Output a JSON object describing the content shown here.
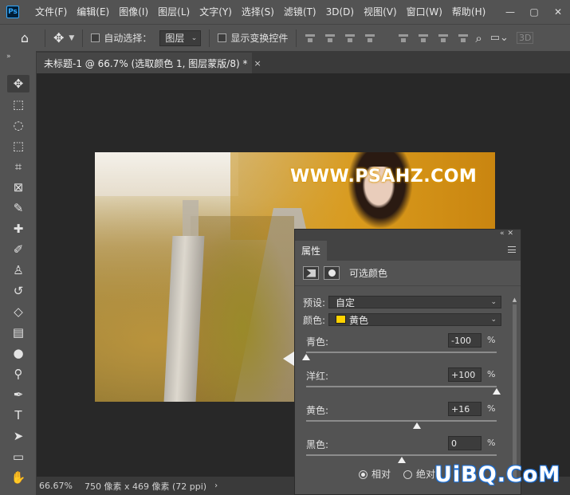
{
  "menubar": {
    "app_icon": "Ps",
    "items": [
      "文件(F)",
      "编辑(E)",
      "图像(I)",
      "图层(L)",
      "文字(Y)",
      "选择(S)",
      "滤镜(T)",
      "3D(D)",
      "视图(V)",
      "窗口(W)",
      "帮助(H)"
    ],
    "window_controls": [
      "—",
      "▢",
      "✕"
    ]
  },
  "options": {
    "auto_select_label": "自动选择：",
    "auto_select_target": "图层",
    "show_transform_label": "显示变换控件",
    "mode_3d": "3D"
  },
  "document": {
    "tab_title": "未标题-1 @ 66.7% (选取颜色 1, 图层蒙版/8) *",
    "close": "×"
  },
  "canvas": {
    "watermark": "WWW.PSAHZ.COM"
  },
  "status": {
    "zoom": "66.67%",
    "doc_info": "750 像素 x 469 像素 (72 ppi)",
    "arrow": "›"
  },
  "properties": {
    "tab_label": "属性",
    "adjustment_title": "可选颜色",
    "preset_label": "预设:",
    "preset_value": "自定",
    "color_label": "颜色:",
    "color_value": "黄色",
    "color_swatch": "#ffd200",
    "sliders": [
      {
        "label": "青色:",
        "value": "-100",
        "pct": "%",
        "amount": -100
      },
      {
        "label": "洋红:",
        "value": "+100",
        "pct": "%",
        "amount": 100
      },
      {
        "label": "黄色:",
        "value": "+16",
        "pct": "%",
        "amount": 16
      },
      {
        "label": "黑色:",
        "value": "0",
        "pct": "%",
        "amount": 0
      }
    ],
    "method": {
      "relative": "相对",
      "absolute": "绝对",
      "selected": "relative"
    }
  },
  "site_watermark": "UiBQ.CoM"
}
